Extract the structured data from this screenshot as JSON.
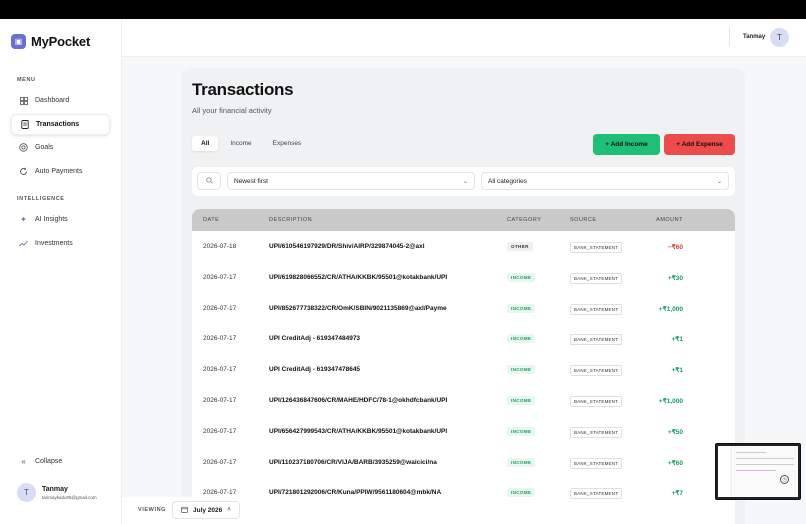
{
  "app": {
    "brand_name": "MyPocket",
    "brand_icon": "wallet-icon"
  },
  "sidebar": {
    "menu_label": "MENU",
    "intelligence_label": "INTELLIGENCE",
    "menu_items": [
      {
        "label": "Dashboard",
        "icon": "grid-icon"
      },
      {
        "label": "Transactions",
        "icon": "receipt-icon",
        "active": true
      },
      {
        "label": "Goals",
        "icon": "target-icon"
      },
      {
        "label": "Auto Payments",
        "icon": "refresh-icon"
      }
    ],
    "intelligence_items": [
      {
        "label": "AI Insights",
        "icon": "sparkle-icon"
      },
      {
        "label": "Investments",
        "icon": "trend-icon"
      }
    ],
    "collapse_label": "Collapse",
    "user": {
      "initial": "T",
      "name": "Tanmay",
      "email": "tanmaykadu08@gmail.com"
    }
  },
  "topbar": {
    "user_name": "Tanmay",
    "avatar_initial": "T"
  },
  "page": {
    "title": "Transactions",
    "subtitle": "All your financial activity",
    "tabs": [
      "All",
      "Income",
      "Expenses"
    ],
    "active_tab": "All",
    "add_income_label": "+ Add Income",
    "add_expense_label": "+ Add Expense"
  },
  "filters": {
    "sort_value": "Newest first",
    "category_value": "All categories"
  },
  "table": {
    "headers": [
      "DATE",
      "DESCRIPTION",
      "CATEGORY",
      "SOURCE",
      "AMOUNT"
    ],
    "rows": [
      {
        "date": "2026-07-18",
        "description": "UPI/610546197929/DR/Shiv/AIRP/329874045-2@axl",
        "category": "OTHER",
        "source": "BANK_STATEMENT",
        "amount": "−₹60",
        "type": "debit"
      },
      {
        "date": "2026-07-17",
        "description": "UPI/619828066552/CR/ATHA/KKBK/95501@kotakbank/UPI",
        "category": "INCOME",
        "source": "BANK_STATEMENT",
        "amount": "+₹30",
        "type": "credit"
      },
      {
        "date": "2026-07-17",
        "description": "UPI/852677738322/CR/OmK/SBIN/9021135869@axl/Payme",
        "category": "INCOME",
        "source": "BANK_STATEMENT",
        "amount": "+₹1,000",
        "type": "credit"
      },
      {
        "date": "2026-07-17",
        "description": "UPI CreditAdj - 619347484973",
        "category": "INCOME",
        "source": "BANK_STATEMENT",
        "amount": "+₹1",
        "type": "credit"
      },
      {
        "date": "2026-07-17",
        "description": "UPI CreditAdj - 619347478645",
        "category": "INCOME",
        "source": "BANK_STATEMENT",
        "amount": "+₹1",
        "type": "credit"
      },
      {
        "date": "2026-07-17",
        "description": "UPI/126436847606/CR/MAHE/HDFC/78-1@okhdfcbank/UPI",
        "category": "INCOME",
        "source": "BANK_STATEMENT",
        "amount": "+₹1,000",
        "type": "credit"
      },
      {
        "date": "2026-07-17",
        "description": "UPI/656427999543/CR/ATHA/KKBK/95501@kotakbank/UPI",
        "category": "INCOME",
        "source": "BANK_STATEMENT",
        "amount": "+₹50",
        "type": "credit"
      },
      {
        "date": "2026-07-17",
        "description": "UPI/110237180706/CR/VIJA/BARB/3935259@waicici/na",
        "category": "INCOME",
        "source": "BANK_STATEMENT",
        "amount": "+₹60",
        "type": "credit"
      },
      {
        "date": "2026-07-17",
        "description": "UPI/721801292006/CR/Kuna/PPIW/9561180604@mbk/NA",
        "category": "INCOME",
        "source": "BANK_STATEMENT",
        "amount": "+₹7",
        "type": "credit"
      }
    ]
  },
  "bottombar": {
    "viewing_label": "VIEWING",
    "month_value": "July 2026"
  },
  "colors": {
    "accent": "#6b6fd4",
    "income_button": "#1fbf77",
    "expense_button": "#ee4c4c",
    "positive": "#1a9a5e",
    "negative": "#d93a3a"
  }
}
